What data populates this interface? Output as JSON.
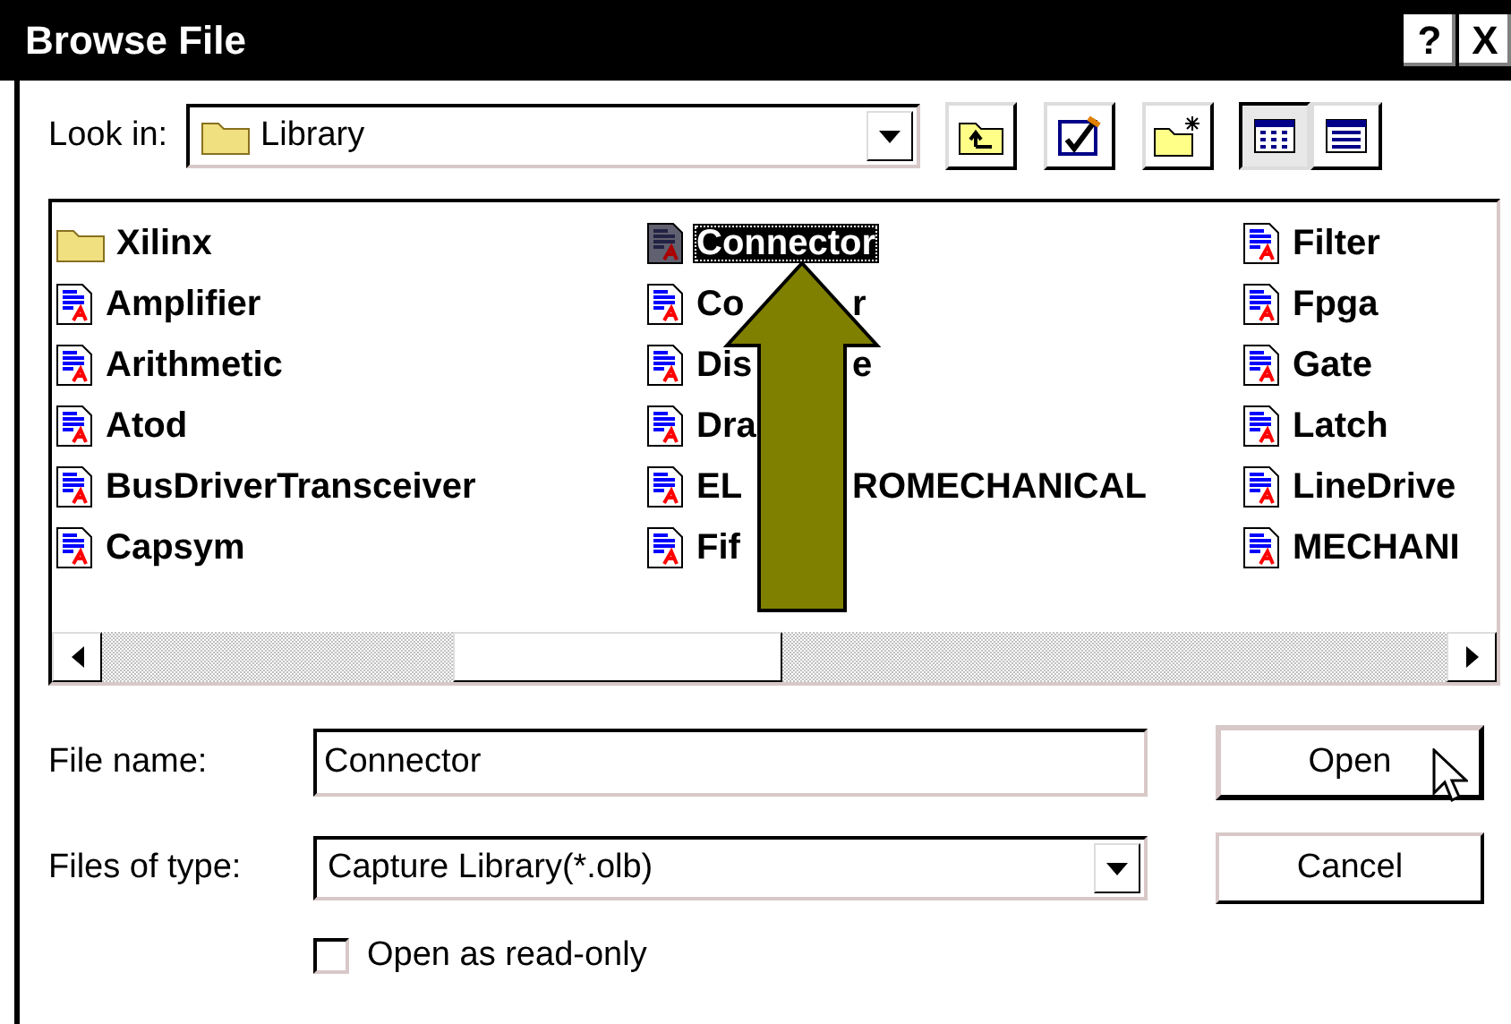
{
  "window": {
    "title": "Browse File",
    "controls": [
      "?",
      "X"
    ]
  },
  "look_in": {
    "label": "Look in:",
    "value": "Library"
  },
  "view_buttons": [
    {
      "kind": "list",
      "selected": true
    },
    {
      "kind": "details",
      "selected": false
    }
  ],
  "columns": [
    {
      "items": [
        {
          "kind": "folder",
          "text": "Xilinx",
          "selected": false
        },
        {
          "kind": "file",
          "text": "Amplifier",
          "selected": false
        },
        {
          "kind": "file",
          "text": "Arithmetic",
          "selected": false
        },
        {
          "kind": "file",
          "text": "Atod",
          "selected": false
        },
        {
          "kind": "file",
          "text": "BusDriverTransceiver",
          "selected": false
        },
        {
          "kind": "file",
          "text": "Capsym",
          "selected": false
        }
      ]
    },
    {
      "items": [
        {
          "kind": "file",
          "text": "Connector",
          "selected": true
        },
        {
          "kind": "file",
          "text": "Co",
          "tail": "r",
          "selected": false
        },
        {
          "kind": "file",
          "text": "Dis",
          "tail": "e",
          "selected": false
        },
        {
          "kind": "file",
          "text": "Dra",
          "selected": false
        },
        {
          "kind": "file",
          "text": "EL",
          "tail": "ROMECHANICAL",
          "selected": false
        },
        {
          "kind": "file",
          "text": "Fif",
          "selected": false
        }
      ]
    },
    {
      "items": [
        {
          "kind": "file",
          "text": "Filter",
          "selected": false
        },
        {
          "kind": "file",
          "text": "Fpga",
          "selected": false
        },
        {
          "kind": "file",
          "text": "Gate",
          "selected": false
        },
        {
          "kind": "file",
          "text": "Latch",
          "selected": false
        },
        {
          "kind": "file",
          "text": "LineDrive",
          "selected": false
        },
        {
          "kind": "file",
          "text": "MECHANI",
          "selected": false
        }
      ]
    }
  ],
  "file_name": {
    "label": "File name:",
    "value": "Connector"
  },
  "file_type": {
    "label": "Files of type:",
    "value": "Capture Library(*.olb)"
  },
  "buttons": [
    {
      "label": "Open",
      "focused": true
    },
    {
      "label": "Cancel",
      "focused": false
    }
  ],
  "read_only": {
    "label": "Open as read-only",
    "checked": false
  }
}
